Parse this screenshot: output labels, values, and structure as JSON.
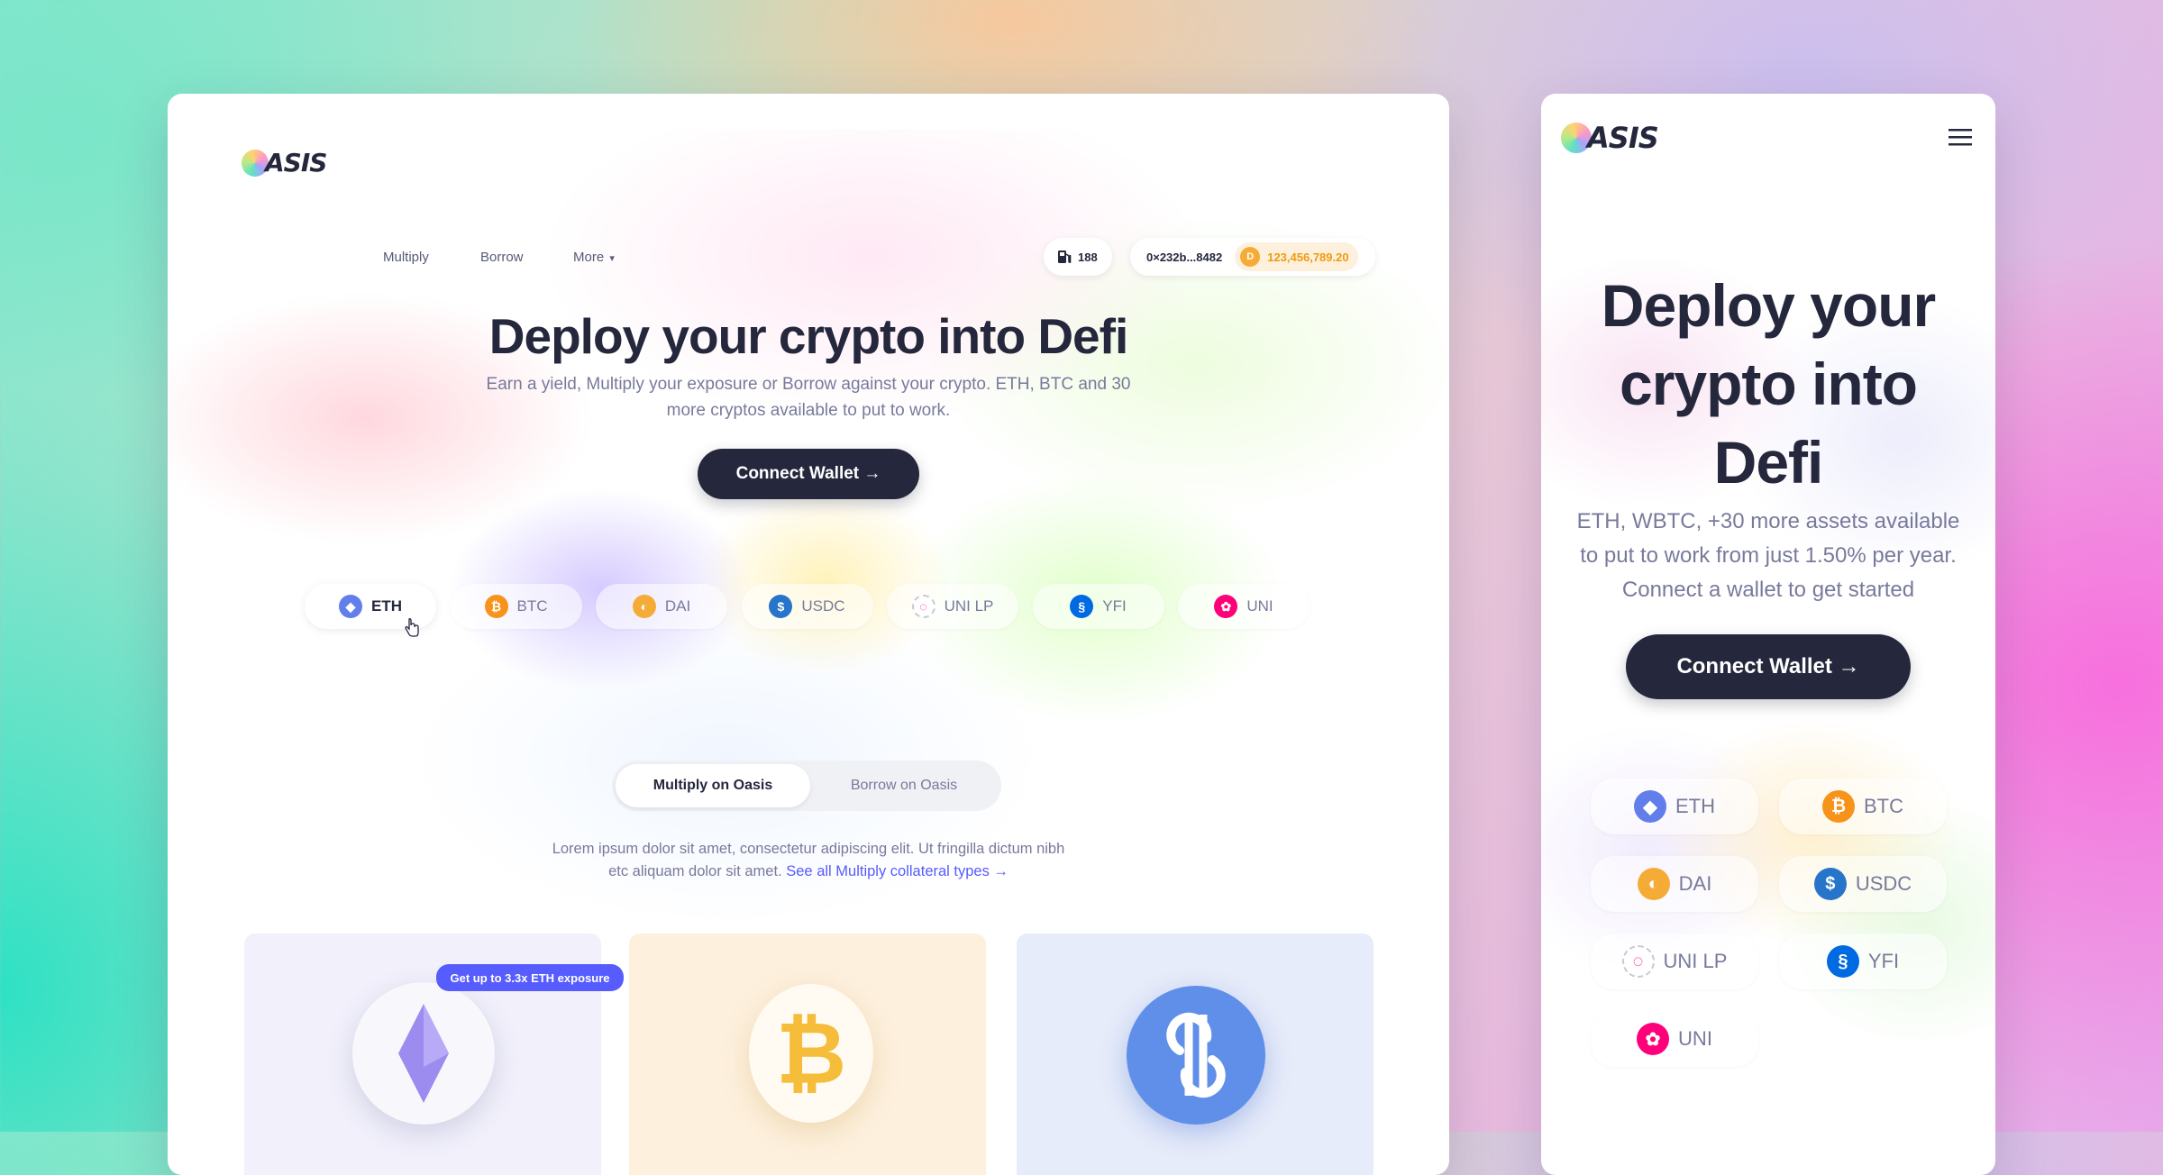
{
  "desktop": {
    "logo_text": "ASIS",
    "nav": [
      {
        "label": "Multiply"
      },
      {
        "label": "Borrow"
      },
      {
        "label": "More"
      }
    ],
    "more_caret": "▾",
    "gas": {
      "value": "188",
      "icon": "gas-pump-icon"
    },
    "wallet": {
      "address": "0×232b...8482",
      "balance": "123,456,789.20",
      "token_icon": "dai-icon"
    },
    "hero": {
      "title": "Deploy your crypto into Defi",
      "subtitle_line1": "Earn a yield, Multiply your exposure or Borrow against your crypto. ETH, BTC and 30",
      "subtitle_line2": "more cryptos available to put to work.",
      "cta": "Connect Wallet →"
    },
    "tokens": [
      {
        "label": "ETH",
        "color": "#627eea",
        "active": true
      },
      {
        "label": "BTC",
        "color": "#f7931a"
      },
      {
        "label": "DAI",
        "color": "#f5ac37"
      },
      {
        "label": "USDC",
        "color": "#2775ca"
      },
      {
        "label": "UNI LP",
        "color": "#ff007a"
      },
      {
        "label": "YFI",
        "color": "#006ae3"
      },
      {
        "label": "UNI",
        "color": "#ff007a"
      }
    ],
    "tabs": [
      {
        "label": "Multiply on Oasis",
        "active": true
      },
      {
        "label": "Borrow on Oasis"
      }
    ],
    "description": {
      "line1": "Lorem ipsum dolor sit amet, consectetur adipiscing elit. Ut fringilla dictum nibh",
      "line2": "etc aliquam dolor sit amet.",
      "link": "See all Multiply collateral types →"
    },
    "cards": [
      {
        "badge": "Get up to 3.3x ETH exposure",
        "token": "ETH",
        "bg": "#f1f0fb"
      },
      {
        "token": "BTC",
        "bg": "#fdf0dd"
      },
      {
        "token": "YFI",
        "bg": "#e7ecfa"
      }
    ]
  },
  "mobile": {
    "logo_text": "ASIS",
    "menu_icon": "hamburger-menu-icon",
    "hero": {
      "title_line1": "Deploy your",
      "title_line2": "crypto into",
      "title_line3": "Defi",
      "sub_line1": "ETH, WBTC, +30 more assets available",
      "sub_line2": "to put to work from just 1.50% per year.",
      "sub_line3": "Connect a wallet to get started",
      "cta": "Connect Wallet →"
    },
    "tokens": [
      {
        "label": "ETH"
      },
      {
        "label": "BTC"
      },
      {
        "label": "DAI"
      },
      {
        "label": "USDC"
      },
      {
        "label": "UNI LP"
      },
      {
        "label": "YFI"
      },
      {
        "label": "UNI"
      }
    ]
  },
  "colors": {
    "primary": "#25273d",
    "accent": "#575cfe",
    "muted": "#787a9b"
  }
}
